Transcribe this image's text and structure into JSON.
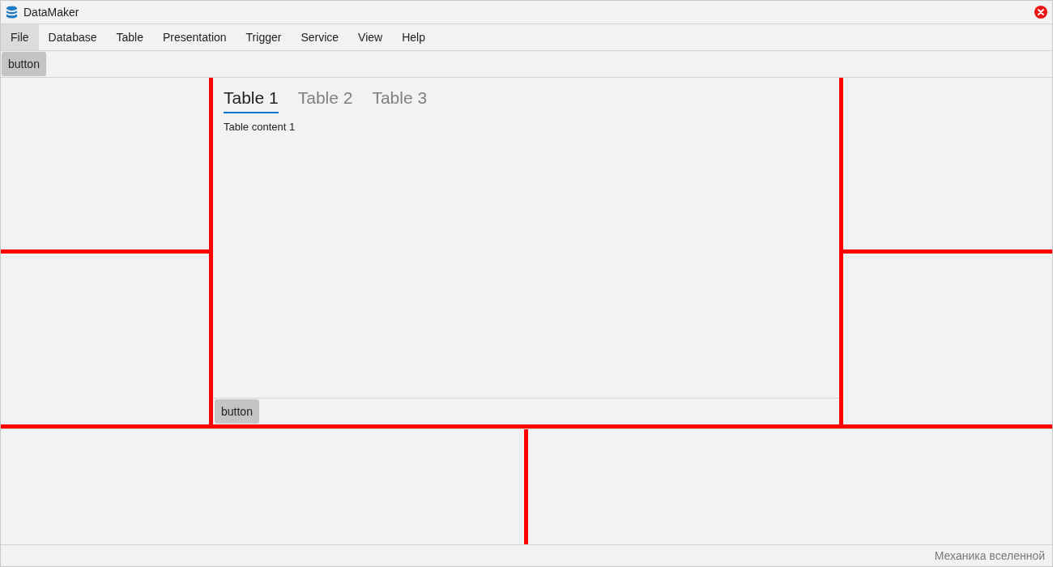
{
  "window": {
    "title": "DataMaker"
  },
  "menu": [
    {
      "label": "File",
      "selected": true
    },
    {
      "label": "Database",
      "selected": false
    },
    {
      "label": "Table",
      "selected": false
    },
    {
      "label": "Presentation",
      "selected": false
    },
    {
      "label": "Trigger",
      "selected": false
    },
    {
      "label": "Service",
      "selected": false
    },
    {
      "label": "View",
      "selected": false
    },
    {
      "label": "Help",
      "selected": false
    }
  ],
  "toolbar": {
    "buttons": [
      "button"
    ]
  },
  "tabs": [
    {
      "label": "Table 1",
      "selected": true
    },
    {
      "label": "Table 2",
      "selected": false
    },
    {
      "label": "Table 3",
      "selected": false
    }
  ],
  "tab_content": "Table content 1",
  "panel_buttons": [
    "button"
  ],
  "status_bar": {
    "text": "Механика вселенной"
  }
}
